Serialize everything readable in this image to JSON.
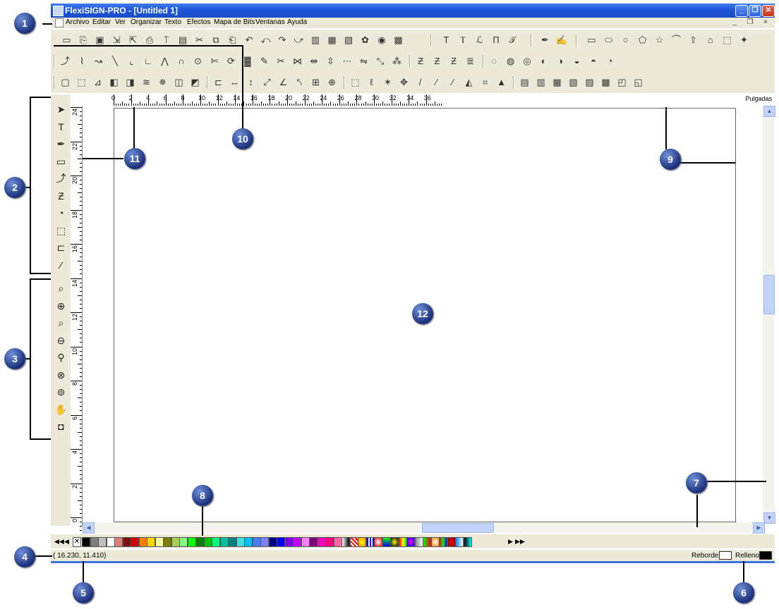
{
  "window": {
    "title": "FlexiSIGN-PRO - [Untitled 1]",
    "buttons": {
      "minimize": "_",
      "restore": "❐",
      "close": "✕"
    }
  },
  "menu": [
    "Archivo",
    "Editar",
    "Ver",
    "Organizar",
    "Texto",
    "Efectos",
    "Mapa de Bits",
    "Ventanas",
    "Ayuda"
  ],
  "mdi_controls": "_ ❐ ×",
  "ruler": {
    "unit_label": "Pulgadas",
    "h_labels": [
      "0",
      "2",
      "4",
      "6",
      "8",
      "10",
      "12",
      "14",
      "16",
      "18",
      "20",
      "22",
      "24",
      "26",
      "28",
      "30",
      "32",
      "34",
      "36"
    ],
    "v_labels": [
      "24",
      "22",
      "20",
      "18",
      "16",
      "14",
      "12",
      "10",
      "8",
      "6",
      "4",
      "2",
      "0"
    ]
  },
  "toolbars": {
    "row1": [
      "new-doc-icon",
      "open-icon",
      "save-icon",
      "import-icon",
      "export-icon",
      "print-icon",
      "cut-path-icon",
      "production-icon",
      "cut-icon",
      "copy-icon",
      "paste-icon",
      "undo-icon",
      "undo-all-icon",
      "redo-icon",
      "redo-all-icon",
      "arrange-icon",
      "properties-icon",
      "preview-icon",
      "color-palette-icon",
      "color-picker-icon",
      "color-grid-icon"
    ],
    "row1_text": [
      "text-icon",
      "text-vertical-icon",
      "text-path-icon",
      "text-arc-icon",
      "text-fit-icon"
    ],
    "row1_pen": [
      "pen-tool-icon",
      "bezier-tool-icon"
    ],
    "row1_shapes": [
      "rectangle-icon",
      "ellipse-icon",
      "circle-icon",
      "polygon-icon",
      "star-icon",
      "arc-icon",
      "arrow-icon",
      "house-icon",
      "bracket-shape-icon",
      "target-icon"
    ],
    "row2": [
      "node-edit-icon",
      "curve-1-icon",
      "curve-2-icon",
      "line-1-icon",
      "corner-icon",
      "angle-icon",
      "peak-icon",
      "arch-icon",
      "circle-node-icon",
      "scissors-node-icon",
      "rotate-node-icon",
      "fill-node-icon",
      "paint-node-icon",
      "cut-node-icon",
      "split-node-icon",
      "align-h-icon",
      "align-v-icon",
      "distribute-icon",
      "mirror-icon",
      "transform-icon",
      "scatter-icon",
      "weld-1-icon",
      "weld-2-icon",
      "weld-3-icon",
      "weld-4-icon",
      "shape-op-1-icon",
      "shape-op-2-icon",
      "shape-op-3-icon",
      "shape-op-4-icon",
      "shape-op-5-icon",
      "shape-op-6-icon",
      "shape-op-7-icon",
      "shape-op-8-icon"
    ],
    "row3": [
      "frame-icon",
      "dotted-frame-icon",
      "perspective-icon",
      "shadow-icon",
      "color-shadow-icon",
      "layers-icon",
      "star-effect-icon",
      "3d-box-icon",
      "bevel-icon",
      "ruler-tool-icon",
      "dimension-h-icon",
      "dimension-v-icon",
      "dimension-d-icon",
      "dimension-angle-icon",
      "dimension-xy-icon",
      "dimension-area-icon",
      "dimension-center-icon",
      "marquee-icon",
      "lasso-icon",
      "magic-wand-icon",
      "move-icon",
      "brush-1-icon",
      "brush-2-icon",
      "brush-3-icon",
      "bucket-icon",
      "crop-icon",
      "stamp-icon",
      "bitmap-1-icon",
      "bitmap-2-icon",
      "bitmap-3-icon",
      "bitmap-4-icon",
      "bitmap-5-icon",
      "bitmap-6-icon",
      "bitmap-7-icon",
      "bitmap-8-icon"
    ]
  },
  "toolbox": {
    "group1": [
      "select-arrow-icon",
      "text-tool-icon",
      "pen-tool-icon",
      "rectangle-tool-icon",
      "node-edit-tool-icon",
      "distort-tool-icon",
      "shape-tool-icon",
      "frame-tool-icon",
      "measure-tool-icon",
      "eyedropper-icon"
    ],
    "group2": [
      "zoom-area-icon",
      "zoom-in-icon",
      "zoom-page-icon",
      "zoom-out-icon",
      "zoom-fit-icon",
      "zoom-reset-icon",
      "zoom-select-icon",
      "hand-pan-icon",
      "color-fill-icon"
    ]
  },
  "palette": {
    "nav_left": [
      "◀◀",
      "◀"
    ],
    "nav_right": [
      "▶",
      "▶▶"
    ],
    "colors": [
      "#000000",
      "#7f7f7f",
      "#c0c0c0",
      "#ffffff",
      "#e07c7c",
      "#7f1010",
      "#d00000",
      "#ff8000",
      "#ffd400",
      "#ffff99",
      "#808000",
      "#a8d050",
      "#80ff80",
      "#00ff00",
      "#007f00",
      "#00c000",
      "#00ff80",
      "#00c0a0",
      "#008080",
      "#40e0e0",
      "#00c0ff",
      "#4080ff",
      "#8080ff",
      "#00007f",
      "#0000ff",
      "#8000ff",
      "#c000ff",
      "#ff80ff",
      "#800080",
      "#ff00c0",
      "#ff0080",
      "#ff66aa"
    ]
  },
  "status": {
    "coords": "(  16.230,    11.410)",
    "outline_label": "Reborde",
    "fill_label": "Relleno"
  },
  "callouts": [
    "1",
    "2",
    "3",
    "4",
    "5",
    "6",
    "7",
    "8",
    "9",
    "10",
    "11",
    "12"
  ]
}
